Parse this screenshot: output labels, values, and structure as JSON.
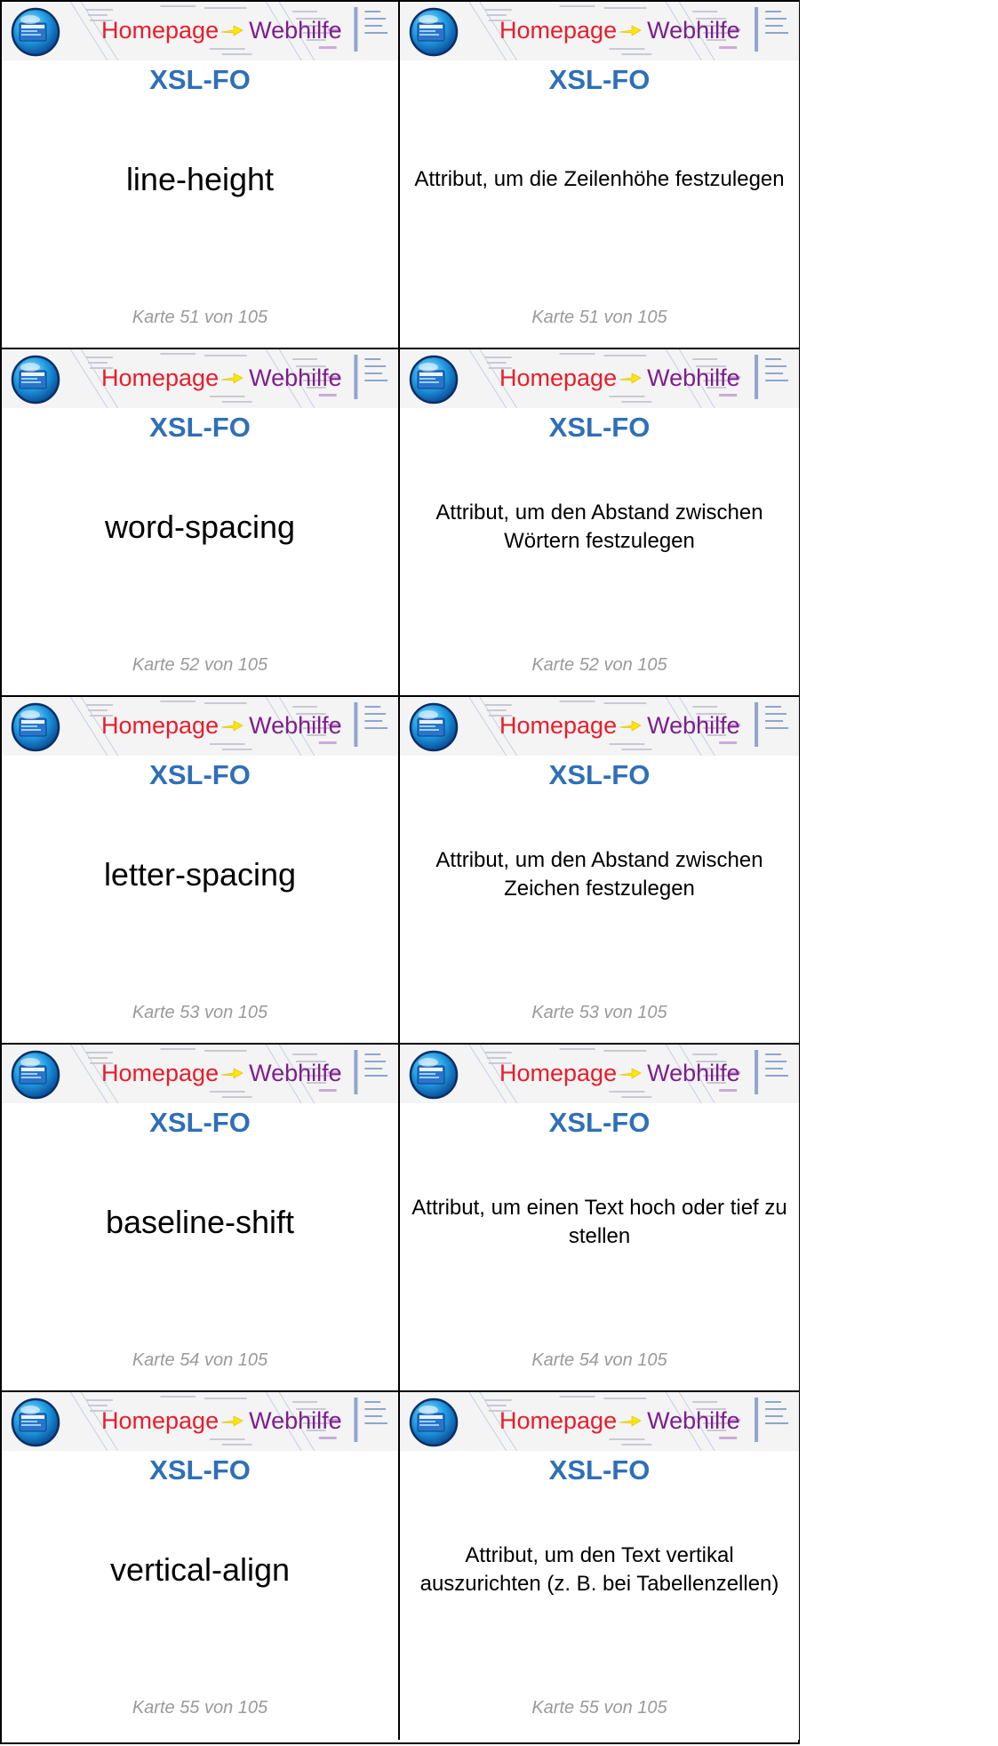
{
  "brand": {
    "home": "Homepage",
    "web": "Webhilfe"
  },
  "cards": [
    {
      "subject": "XSL-FO",
      "front": "line-height",
      "back": "Attribut, um die Zeilenhöhe festzulegen",
      "footer": "Karte 51 von 105"
    },
    {
      "subject": "XSL-FO",
      "front": "word-spacing",
      "back": "Attribut, um den Abstand zwischen Wörtern festzulegen",
      "footer": "Karte 52 von 105"
    },
    {
      "subject": "XSL-FO",
      "front": "letter-spacing",
      "back": "Attribut, um den Abstand zwischen Zeichen festzulegen",
      "footer": "Karte 53 von 105"
    },
    {
      "subject": "XSL-FO",
      "front": "baseline-shift",
      "back": "Attribut, um einen Text hoch oder tief zu stellen",
      "footer": "Karte 54 von 105"
    },
    {
      "subject": "XSL-FO",
      "front": "vertical-align",
      "back": "Attribut, um den Text vertikal auszurichten (z. B. bei Tabellenzellen)",
      "footer": "Karte 55 von 105"
    }
  ],
  "colors": {
    "subject": "#2f6fb8",
    "brand_home": "#e81d2a",
    "brand_web": "#7d1e8c",
    "footer": "#9a9a9a"
  },
  "icons": {
    "logo": "globe-logo-icon",
    "arrow": "arrow-right-icon"
  }
}
